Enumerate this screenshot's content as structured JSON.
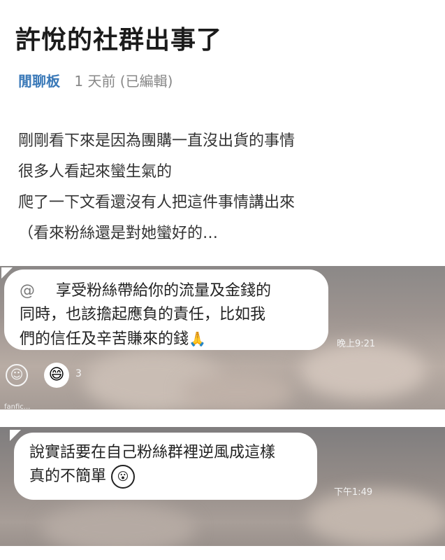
{
  "post": {
    "title": "許悅的社群出事了",
    "board": "閒聊板",
    "time": "1 天前 (已編輯)",
    "lines": [
      "剛剛看下來是因為團購一直沒出貨的事情",
      "很多人看起來蠻生氣的",
      "爬了一下文看還沒有人把這件事情講出來",
      "（看來粉絲還是對她蠻好的…"
    ]
  },
  "screenshot1": {
    "mention": "@",
    "lines": [
      "享受粉絲帶給你的流量及金錢的",
      "同時，也該擔起應負的責任，比如我",
      "們的信任及辛苦賺來的錢"
    ],
    "emoji": "🙏",
    "timestamp": "晚上9:21",
    "reaction_icon": "smile-icon",
    "reaction_count": "3",
    "truncated_label": "fanfic..."
  },
  "screenshot2": {
    "lines": [
      "說實話要在自己粉絲群裡逆風成這樣",
      "真的不簡單"
    ],
    "emoji": "😮",
    "timestamp": "下午1:49"
  },
  "colors": {
    "board": "#3a79b8",
    "title": "#1b1b1b",
    "body": "#333333"
  }
}
